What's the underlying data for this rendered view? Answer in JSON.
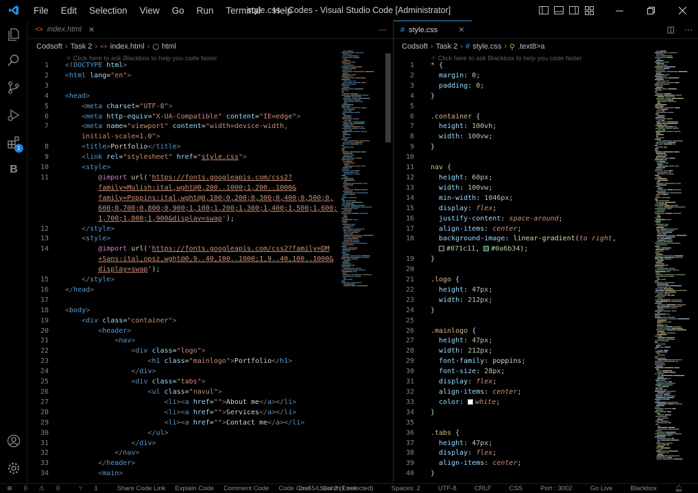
{
  "window": {
    "title": "style.css - Codes - Visual Studio Code [Administrator]",
    "menu": [
      "File",
      "Edit",
      "Selection",
      "View",
      "Go",
      "Run",
      "Terminal",
      "Help"
    ]
  },
  "activity": {
    "extensions_badge": "1",
    "blackbox_letter": "B"
  },
  "left": {
    "tab_label": "index.html",
    "breadcrumb": [
      "Codsoft",
      "Task 2",
      "index.html",
      "html"
    ],
    "hint": "Click here to ask Blackbox to help you code faster"
  },
  "right": {
    "tab_label": "style.css",
    "breadcrumb": [
      "Codsoft",
      "Task 2",
      "style.css",
      ".text8>a"
    ],
    "hint": "Click here to ask Blackbox to help you code faster"
  },
  "left_lines": [
    {
      "n": "1",
      "html": "<span class='p'>&lt;</span><span class='t'>!DOCTYPE</span> <span class='a'>html</span><span class='p'>&gt;</span>"
    },
    {
      "n": "2",
      "html": "<span class='p'>&lt;</span><span class='t'>html</span> <span class='a'>lang</span><span class='pl'>=</span><span class='s'>\"en\"</span><span class='p'>&gt;</span>"
    },
    {
      "n": "3",
      "html": ""
    },
    {
      "n": "4",
      "html": "<span class='p'>&lt;</span><span class='t'>head</span><span class='p'>&gt;</span>"
    },
    {
      "n": "5",
      "html": "    <span class='p'>&lt;</span><span class='t'>meta</span> <span class='a'>charset</span><span class='pl'>=</span><span class='s'>\"UTF-8\"</span><span class='p'>&gt;</span>"
    },
    {
      "n": "6",
      "html": "    <span class='p'>&lt;</span><span class='t'>meta</span> <span class='a'>http-equiv</span><span class='pl'>=</span><span class='s'>\"X-UA-Compatible\"</span> <span class='a'>content</span><span class='pl'>=</span><span class='s'>\"IE=edge\"</span><span class='p'>&gt;</span>"
    },
    {
      "n": "7",
      "html": "    <span class='p'>&lt;</span><span class='t'>meta</span> <span class='a'>name</span><span class='pl'>=</span><span class='s'>\"viewport\"</span> <span class='a'>content</span><span class='pl'>=</span><span class='s'>\"width=device-width,</span>"
    },
    {
      "n": "",
      "html": "    <span class='s'>initial-scale=1.0\"</span><span class='p'>&gt;</span>"
    },
    {
      "n": "8",
      "html": "    <span class='p'>&lt;</span><span class='t'>title</span><span class='p'>&gt;</span><span class='pl'>Portfolio</span><span class='p'>&lt;/</span><span class='t'>title</span><span class='p'>&gt;</span>"
    },
    {
      "n": "9",
      "html": "    <span class='p'>&lt;</span><span class='t'>link</span> <span class='a'>rel</span><span class='pl'>=</span><span class='s'>\"stylesheet\"</span> <span class='a'>href</span><span class='pl'>=</span><span class='s'>\"</span><span class='u'>style.css</span><span class='s'>\"</span><span class='p'>&gt;</span>"
    },
    {
      "n": "10",
      "html": "    <span class='p'>&lt;</span><span class='t'>style</span><span class='p'>&gt;</span>"
    },
    {
      "n": "11",
      "html": "        <span class='at'>@import</span> <span class='f'>url</span><span class='pl'>(</span><span class='s'>'</span><span class='u'>https://fonts.googleapis.com/css2?</span>"
    },
    {
      "n": "",
      "html": "        <span class='u'>family=Mulish:ital,wght@0,200..1000;1,200..1000&amp;</span>"
    },
    {
      "n": "",
      "html": "        <span class='u'>family=Poppins:ital,wght@0,100;0,200;0,300;0,400;0,500;0,</span>"
    },
    {
      "n": "",
      "html": "        <span class='u'>600;0,700;0,800;0,900;1,100;1,200;1,300;1,400;1,500;1,600;</span>"
    },
    {
      "n": "",
      "html": "        <span class='u'>1,700;1,800;1,900&amp;display=swap</span><span class='s'>'</span><span class='pl'>);</span>"
    },
    {
      "n": "12",
      "html": "    <span class='p'>&lt;/</span><span class='t'>style</span><span class='p'>&gt;</span>"
    },
    {
      "n": "13",
      "html": "    <span class='p'>&lt;</span><span class='t'>style</span><span class='p'>&gt;</span>"
    },
    {
      "n": "14",
      "html": "        <span class='at'>@import</span> <span class='f'>url</span><span class='pl'>(</span><span class='s'>'</span><span class='u'>https://fonts.googleapis.com/css2?family=DM</span>"
    },
    {
      "n": "",
      "html": "        <span class='u'>+Sans:ital,opsz,wght@0,9..40,100..1000;1,9..40,100..1000&amp;</span>"
    },
    {
      "n": "",
      "html": "        <span class='u'>display=swap</span><span class='s'>'</span><span class='pl'>);</span>"
    },
    {
      "n": "15",
      "html": "    <span class='p'>&lt;/</span><span class='t'>style</span><span class='p'>&gt;</span>"
    },
    {
      "n": "16",
      "html": "<span class='p'>&lt;/</span><span class='t'>head</span><span class='p'>&gt;</span>"
    },
    {
      "n": "17",
      "html": ""
    },
    {
      "n": "18",
      "html": "<span class='p'>&lt;</span><span class='t'>body</span><span class='p'>&gt;</span>"
    },
    {
      "n": "19",
      "html": "    <span class='p'>&lt;</span><span class='t'>div</span> <span class='a'>class</span><span class='pl'>=</span><span class='s'>\"container\"</span><span class='p'>&gt;</span>"
    },
    {
      "n": "20",
      "html": "        <span class='p'>&lt;</span><span class='t'>header</span><span class='p'>&gt;</span>"
    },
    {
      "n": "21",
      "html": "            <span class='p'>&lt;</span><span class='t'>nav</span><span class='p'>&gt;</span>"
    },
    {
      "n": "22",
      "html": "                <span class='p'>&lt;</span><span class='t'>div</span> <span class='a'>class</span><span class='pl'>=</span><span class='s'>\"logo\"</span><span class='p'>&gt;</span>"
    },
    {
      "n": "23",
      "html": "                    <span class='p'>&lt;</span><span class='t'>h1</span> <span class='a'>class</span><span class='pl'>=</span><span class='s'>\"mainlogo\"</span><span class='p'>&gt;</span><span class='pl'>Portfolio</span><span class='p'>&lt;/</span><span class='t'>h1</span><span class='p'>&gt;</span>"
    },
    {
      "n": "24",
      "html": "                <span class='p'>&lt;/</span><span class='t'>div</span><span class='p'>&gt;</span>"
    },
    {
      "n": "25",
      "html": "                <span class='p'>&lt;</span><span class='t'>div</span> <span class='a'>class</span><span class='pl'>=</span><span class='s'>\"tabs\"</span><span class='p'>&gt;</span>"
    },
    {
      "n": "26",
      "html": "                    <span class='p'>&lt;</span><span class='t'>ul</span> <span class='a'>class</span><span class='pl'>=</span><span class='s'>\"navul\"</span><span class='p'>&gt;</span>"
    },
    {
      "n": "27",
      "html": "                        <span class='p'>&lt;</span><span class='t'>li</span><span class='p'>&gt;&lt;</span><span class='t'>a</span> <span class='a'>href</span><span class='pl'>=</span><span class='s'>\"\"</span><span class='p'>&gt;</span><span class='pl'>About me</span><span class='p'>&lt;/</span><span class='t'>a</span><span class='p'>&gt;&lt;/</span><span class='t'>li</span><span class='p'>&gt;</span>"
    },
    {
      "n": "28",
      "html": "                        <span class='p'>&lt;</span><span class='t'>li</span><span class='p'>&gt;&lt;</span><span class='t'>a</span> <span class='a'>href</span><span class='pl'>=</span><span class='s'>\"\"</span><span class='p'>&gt;</span><span class='pl'>Services</span><span class='p'>&lt;/</span><span class='t'>a</span><span class='p'>&gt;&lt;/</span><span class='t'>li</span><span class='p'>&gt;</span>"
    },
    {
      "n": "29",
      "html": "                        <span class='p'>&lt;</span><span class='t'>li</span><span class='p'>&gt;&lt;</span><span class='t'>a</span> <span class='a'>href</span><span class='pl'>=</span><span class='s'>\"\"</span><span class='p'>&gt;</span><span class='pl'>Contact me</span><span class='p'>&lt;/</span><span class='t'>a</span><span class='p'>&gt;&lt;/</span><span class='t'>li</span><span class='p'>&gt;</span>"
    },
    {
      "n": "30",
      "html": "                    <span class='p'>&lt;/</span><span class='t'>ul</span><span class='p'>&gt;</span>"
    },
    {
      "n": "31",
      "html": "                <span class='p'>&lt;/</span><span class='t'>div</span><span class='p'>&gt;</span>"
    },
    {
      "n": "32",
      "html": "            <span class='p'>&lt;/</span><span class='t'>nav</span><span class='p'>&gt;</span>"
    },
    {
      "n": "33",
      "html": "        <span class='p'>&lt;/</span><span class='t'>header</span><span class='p'>&gt;</span>"
    },
    {
      "n": "34",
      "html": "        <span class='p'>&lt;</span><span class='t'>main</span><span class='p'>&gt;</span>"
    }
  ],
  "right_lines": [
    {
      "n": "1",
      "html": "<span class='c'>*</span> <span class='pl'>{</span>"
    },
    {
      "n": "2",
      "html": "  <span class='a'>margin</span><span class='pl'>:</span> <span class='n'>0</span><span class='pl'>;</span>"
    },
    {
      "n": "3",
      "html": "  <span class='a'>padding</span><span class='pl'>:</span> <span class='n'>0</span><span class='pl'>;</span>"
    },
    {
      "n": "4",
      "html": "<span class='pl'>}</span>"
    },
    {
      "n": "5",
      "html": ""
    },
    {
      "n": "6",
      "html": "<span class='c'>.container</span> <span class='pl'>{</span>"
    },
    {
      "n": "7",
      "html": "  <span class='a'>height</span><span class='pl'>:</span> <span class='n'>100vh</span><span class='pl'>;</span>"
    },
    {
      "n": "8",
      "html": "  <span class='a'>width</span><span class='pl'>:</span> <span class='n'>100vw</span><span class='pl'>;</span>"
    },
    {
      "n": "9",
      "html": "<span class='pl'>}</span>"
    },
    {
      "n": "10",
      "html": ""
    },
    {
      "n": "11",
      "html": "<span class='c'>nav</span> <span class='pl'>{</span>"
    },
    {
      "n": "12",
      "html": "  <span class='a'>height</span><span class='pl'>:</span> <span class='n'>60px</span><span class='pl'>;</span>"
    },
    {
      "n": "13",
      "html": "  <span class='a'>width</span><span class='pl'>:</span> <span class='n'>100vw</span><span class='pl'>;</span>"
    },
    {
      "n": "14",
      "html": "  <span class='a'>min-width</span><span class='pl'>:</span> <span class='n'>1046px</span><span class='pl'>;</span>"
    },
    {
      "n": "15",
      "html": "  <span class='a'>display</span><span class='pl'>:</span> <span class='k'>flex</span><span class='pl'>;</span>"
    },
    {
      "n": "16",
      "html": "  <span class='a'>justify-content</span><span class='pl'>:</span> <span class='k'>space-around</span><span class='pl'>;</span>"
    },
    {
      "n": "17",
      "html": "  <span class='a'>align-items</span><span class='pl'>:</span> <span class='k'>center</span><span class='pl'>;</span>"
    },
    {
      "n": "18",
      "html": "  <span class='a'>background-image</span><span class='pl'>:</span> <span class='f'>linear-gradient</span><span class='pl'>(</span><span class='k'>to right</span><span class='pl'>,</span>"
    },
    {
      "n": "",
      "html": "  <span class='sw' style='background:#071c11'></span><span class='n'>#071c11</span><span class='pl'>, </span><span class='sw' style='background:#0a6b34'></span><span class='n'>#0a6b34</span><span class='pl'>);</span>"
    },
    {
      "n": "19",
      "html": "<span class='pl'>}</span>"
    },
    {
      "n": "20",
      "html": ""
    },
    {
      "n": "21",
      "html": "<span class='c'>.logo</span> <span class='pl'>{</span>"
    },
    {
      "n": "22",
      "html": "  <span class='a'>height</span><span class='pl'>:</span> <span class='n'>47px</span><span class='pl'>;</span>"
    },
    {
      "n": "23",
      "html": "  <span class='a'>width</span><span class='pl'>:</span> <span class='n'>212px</span><span class='pl'>;</span>"
    },
    {
      "n": "24",
      "html": "<span class='pl'>}</span>"
    },
    {
      "n": "25",
      "html": ""
    },
    {
      "n": "26",
      "html": "<span class='c'>.mainlogo</span> <span class='pl'>{</span>"
    },
    {
      "n": "27",
      "html": "  <span class='a'>height</span><span class='pl'>:</span> <span class='n'>47px</span><span class='pl'>;</span>"
    },
    {
      "n": "28",
      "html": "  <span class='a'>width</span><span class='pl'>:</span> <span class='n'>212px</span><span class='pl'>;</span>"
    },
    {
      "n": "29",
      "html": "  <span class='a'>font-family</span><span class='pl'>:</span> <span class='pl'>poppins;</span>"
    },
    {
      "n": "30",
      "html": "  <span class='a'>font-size</span><span class='pl'>:</span> <span class='n'>28px</span><span class='pl'>;</span>"
    },
    {
      "n": "31",
      "html": "  <span class='a'>display</span><span class='pl'>:</span> <span class='k'>flex</span><span class='pl'>;</span>"
    },
    {
      "n": "32",
      "html": "  <span class='a'>align-items</span><span class='pl'>:</span> <span class='k'>center</span><span class='pl'>;</span>"
    },
    {
      "n": "33",
      "html": "  <span class='a'>color</span><span class='pl'>:</span> <span class='sw' style='background:#ffffff'></span><span class='k'>white</span><span class='pl'>;</span>"
    },
    {
      "n": "34",
      "html": "<span class='pl'>}</span>"
    },
    {
      "n": "35",
      "html": ""
    },
    {
      "n": "36",
      "html": "<span class='c'>.tabs</span> <span class='pl'>{</span>"
    },
    {
      "n": "37",
      "html": "  <span class='a'>height</span><span class='pl'>:</span> <span class='n'>47px</span><span class='pl'>;</span>"
    },
    {
      "n": "38",
      "html": "  <span class='a'>display</span><span class='pl'>:</span> <span class='k'>flex</span><span class='pl'>;</span>"
    },
    {
      "n": "39",
      "html": "  <span class='a'>align-items</span><span class='pl'>:</span> <span class='k'>center</span><span class='pl'>;</span>"
    },
    {
      "n": "40",
      "html": "<span class='pl'>}</span>"
    }
  ],
  "status": {
    "errors": "0",
    "warnings": "0",
    "ports_count": "1",
    "items": [
      "Share Code Link",
      "Explain Code",
      "Comment Code",
      "Code Chat",
      "Search Error"
    ],
    "right": [
      "Ln 654, Col 2 (1 selected)",
      "Spaces: 2",
      "UTF-8",
      "CRLF",
      "CSS",
      "Port : 3002",
      "Go Live",
      "Blackbox"
    ]
  }
}
